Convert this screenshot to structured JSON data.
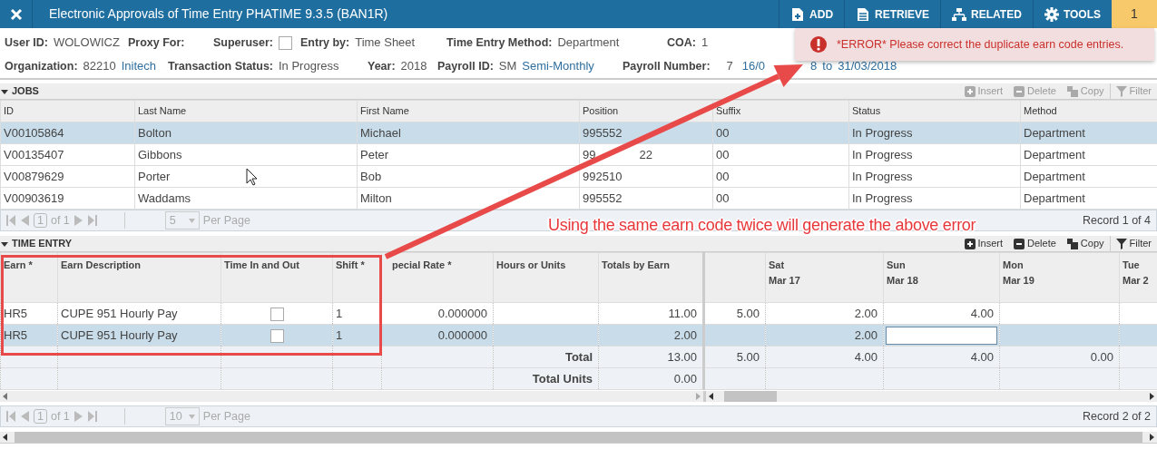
{
  "header": {
    "title": "Electronic Approvals of Time Entry PHATIME 9.3.5 (BAN1R)",
    "actions": [
      {
        "label": "ADD"
      },
      {
        "label": "RETRIEVE"
      },
      {
        "label": "RELATED"
      },
      {
        "label": "TOOLS"
      }
    ],
    "notification_count": "1"
  },
  "key_block": {
    "lines": [
      {
        "fields": [
          {
            "label": "User ID:",
            "parts": [
              {
                "kind": "text",
                "text": "WOLOWICZ"
              }
            ]
          },
          {
            "label": "Proxy For:"
          },
          {
            "label": "Superuser:",
            "kind": "checkbox",
            "checked": false
          },
          {
            "label": "Entry by:",
            "parts": [
              {
                "kind": "text",
                "text": "Time Sheet"
              }
            ]
          },
          {
            "label": "Time Entry Method:",
            "parts": [
              {
                "kind": "text",
                "text": "Department"
              }
            ]
          },
          {
            "label": "COA:",
            "parts": [
              {
                "kind": "text",
                "text": "1"
              }
            ]
          }
        ]
      },
      {
        "fields": [
          {
            "label": "Organization:",
            "parts": [
              {
                "kind": "text",
                "text": "82210"
              },
              {
                "kind": "link",
                "text": "Initech"
              }
            ]
          },
          {
            "label": "Transaction Status:",
            "parts": [
              {
                "kind": "text",
                "text": "In Progress"
              }
            ]
          },
          {
            "label": "Year:",
            "parts": [
              {
                "kind": "text",
                "text": "2018"
              }
            ]
          },
          {
            "label": "Payroll ID:",
            "parts": [
              {
                "kind": "text",
                "text": "SM"
              },
              {
                "kind": "link",
                "text": "Semi-Monthly"
              }
            ]
          },
          {
            "label": "Payroll Number:",
            "parts": [
              {
                "kind": "text",
                "text": "7"
              },
              {
                "kind": "link",
                "text": "16/0"
              },
              {
                "kind": "link",
                "text": "8"
              },
              {
                "kind": "link",
                "text": "to"
              },
              {
                "kind": "link",
                "text": "31/03/2018"
              }
            ]
          }
        ]
      }
    ]
  },
  "error": {
    "message": "*ERROR* Please correct the duplicate earn code entries."
  },
  "jobs": {
    "title": "JOBS",
    "expanded": true,
    "toolbar": [
      {
        "label": "Insert",
        "disabled": true
      },
      {
        "label": "Delete",
        "disabled": true
      },
      {
        "label": "Copy",
        "disabled": true
      },
      {
        "label": "Filter",
        "disabled": true
      }
    ],
    "columns": [
      "ID",
      "Last Name",
      "First Name",
      "Position",
      "Suffix",
      "Status",
      "Method"
    ],
    "rows": [
      {
        "selected": true,
        "cells": [
          "V00105864",
          "Bolton",
          "Michael",
          "995552",
          "00",
          "In Progress",
          "Department"
        ]
      },
      {
        "selected": false,
        "cells": [
          "V00135407",
          "Gibbons",
          "Peter",
          [
            "99",
            "22"
          ],
          "00",
          "In Progress",
          "Department"
        ]
      },
      {
        "selected": false,
        "cells": [
          "V00879629",
          "Porter",
          "Bob",
          "992510",
          "00",
          "In Progress",
          "Department"
        ]
      },
      {
        "selected": false,
        "cells": [
          "V00903619",
          "Waddams",
          "Milton",
          "995552",
          "00",
          "In Progress",
          "Department"
        ]
      }
    ],
    "pager": {
      "page": "1",
      "of": "of 1",
      "per_page": "5",
      "per_page_label": "Per Page",
      "record": "Record 1 of 4"
    }
  },
  "time_entry": {
    "title": "TIME ENTRY",
    "expanded": true,
    "toolbar": [
      {
        "label": "Insert",
        "disabled": false
      },
      {
        "label": "Delete",
        "disabled": false
      },
      {
        "label": "Copy",
        "disabled": false
      },
      {
        "label": "Filter",
        "disabled": false
      }
    ],
    "columns": [
      "Earn *",
      "Earn Description",
      "Time In and Out",
      "Shift *",
      "pecial Rate *",
      "Hours or Units",
      "Totals by Earn"
    ],
    "day_columns": [
      {
        "kind": "blank"
      },
      {
        "kind": "day",
        "day": "Sat",
        "date": "Mar 17"
      },
      {
        "kind": "day",
        "day": "Sun",
        "date": "Mar 18"
      },
      {
        "kind": "day",
        "day": "Mon",
        "date": "Mar 19"
      },
      {
        "kind": "day",
        "day": "Tue",
        "date": "Mar 2"
      }
    ],
    "rows": [
      {
        "selected": false,
        "earn": "HR5",
        "description": "CUPE 951 Hourly Pay",
        "time_in_out": false,
        "shift": "1",
        "special_rate": "0.000000",
        "total": "11.00",
        "days": [
          {
            "kind": "value",
            "value": "5.00"
          },
          {
            "kind": "value",
            "value": "2.00"
          },
          {
            "kind": "value",
            "value": "4.00"
          },
          {
            "kind": "empty"
          },
          {
            "kind": "empty"
          }
        ]
      },
      {
        "selected": true,
        "earn": "HR5",
        "description": "CUPE 951 Hourly Pay",
        "time_in_out": false,
        "shift": "1",
        "special_rate": "0.000000",
        "total": "2.00",
        "days": [
          {
            "kind": "empty"
          },
          {
            "kind": "value",
            "value": "2.00"
          },
          {
            "kind": "editing"
          },
          {
            "kind": "empty"
          },
          {
            "kind": "empty"
          }
        ]
      }
    ],
    "totals": [
      {
        "label": "Total",
        "total": "13.00",
        "days": [
          {
            "kind": "value",
            "value": "5.00"
          },
          {
            "kind": "value",
            "value": "4.00"
          },
          {
            "kind": "value",
            "value": "4.00"
          },
          {
            "kind": "value",
            "value": "0.00"
          },
          {
            "kind": "empty"
          }
        ]
      },
      {
        "label": "Total Units",
        "total": "0.00",
        "days": [
          {
            "kind": "empty"
          },
          {
            "kind": "empty"
          },
          {
            "kind": "empty"
          },
          {
            "kind": "empty"
          },
          {
            "kind": "empty"
          }
        ]
      }
    ],
    "pager": {
      "page": "1",
      "of": "of 1",
      "per_page": "10",
      "per_page_label": "Per Page",
      "record": "Record 2 of 2"
    }
  },
  "annotation": {
    "text": "Using the same earn code twice will generate the above error"
  }
}
